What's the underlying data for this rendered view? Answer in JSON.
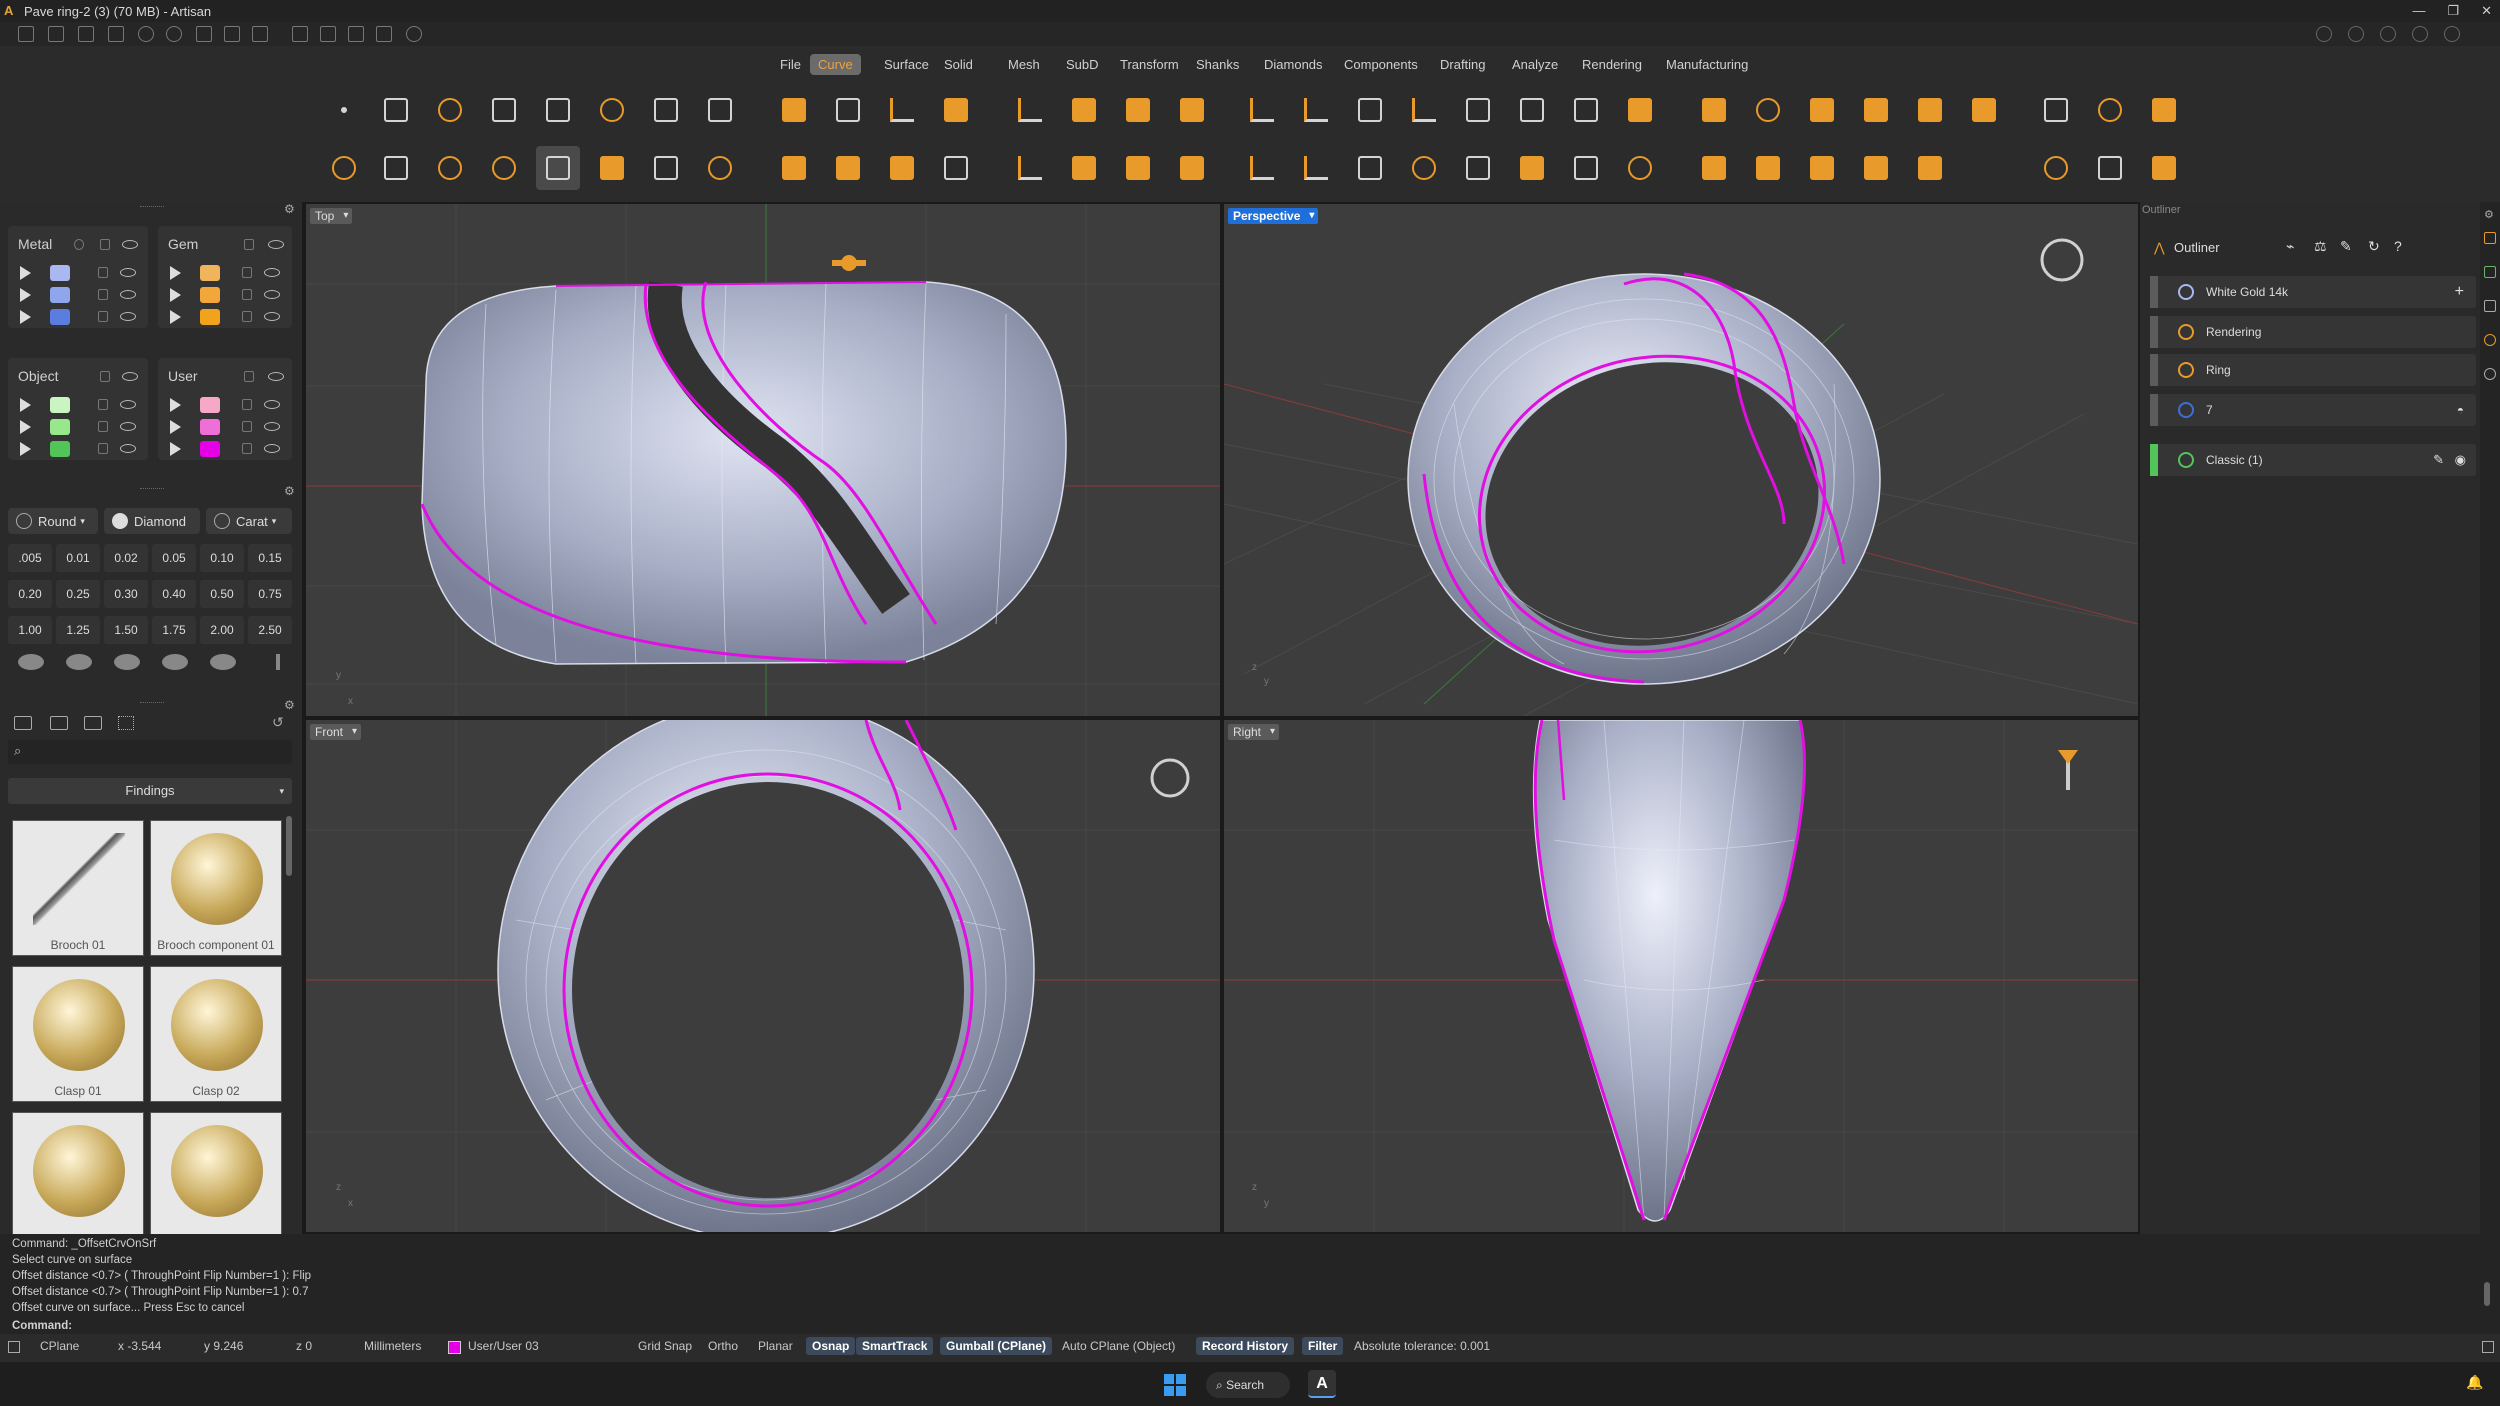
{
  "window": {
    "title": "Pave ring-2 (3) (70 MB) - Artisan",
    "controls": [
      "minimize",
      "restore",
      "close"
    ]
  },
  "menu": {
    "items": [
      "File",
      "Curve",
      "Surface",
      "Solid",
      "Mesh",
      "SubD",
      "Transform",
      "Shanks",
      "Diamonds",
      "Components",
      "Drafting",
      "Analyze",
      "Rendering",
      "Manufacturing"
    ],
    "active": "Curve"
  },
  "layers": {
    "metal": {
      "label": "Metal",
      "colors": [
        "#a9b8f0",
        "#8fa6ec",
        "#5b7de0"
      ]
    },
    "gem": {
      "label": "Gem",
      "colors": [
        "#f0b45a",
        "#f3a73b",
        "#f2a31c"
      ]
    },
    "object": {
      "label": "Object",
      "colors": [
        "#c9f5c0",
        "#96e88a",
        "#52c45a"
      ]
    },
    "user": {
      "label": "User",
      "colors": [
        "#f7a8c8",
        "#f06ed8",
        "#e600e6"
      ]
    }
  },
  "gems": {
    "shape_label": "Round",
    "type_label": "Diamond",
    "unit_label": "Carat",
    "carats": [
      ".005",
      "0.01",
      "0.02",
      "0.05",
      "0.10",
      "0.15",
      "0.20",
      "0.25",
      "0.30",
      "0.40",
      "0.50",
      "0.75",
      "1.00",
      "1.25",
      "1.50",
      "1.75",
      "2.00",
      "2.50"
    ]
  },
  "library": {
    "search_placeholder": "",
    "section_label": "Findings",
    "items": [
      "Brooch 01",
      "Brooch component 01",
      "Clasp 01",
      "Clasp 02",
      "",
      ""
    ]
  },
  "viewports": {
    "top": "Top",
    "perspective": "Perspective",
    "front": "Front",
    "right": "Right"
  },
  "outliner": {
    "header": "Outliner",
    "items": [
      {
        "label": "White Gold 14k",
        "color": "#a9b8f0"
      },
      {
        "label": "Rendering",
        "color": "#e89a2a"
      },
      {
        "label": "Ring",
        "color": "#e89a2a"
      },
      {
        "label": "7",
        "color": "#3c6fd8"
      },
      {
        "label": "Classic (1)",
        "color": "#52c45a"
      }
    ]
  },
  "command_history": [
    "Command: _OffsetCrvOnSrf",
    "Select curve on surface",
    "Offset distance <0.7> ( ThroughPoint  Flip  Number=1 ): Flip",
    "Offset distance <0.7> ( ThroughPoint  Flip  Number=1 ): 0.7",
    "Offset curve on surface... Press Esc to cancel"
  ],
  "command_prompt": "Command:",
  "status": {
    "cplane": "CPlane",
    "x": "x -3.544",
    "y": "y 9.246",
    "z": "z 0",
    "units": "Millimeters",
    "layer": "User/User 03",
    "layer_color": "#e600e6",
    "toggles": [
      {
        "label": "Grid Snap",
        "on": false
      },
      {
        "label": "Ortho",
        "on": false
      },
      {
        "label": "Planar",
        "on": false
      },
      {
        "label": "Osnap",
        "on": true
      },
      {
        "label": "SmartTrack",
        "on": true
      },
      {
        "label": "Gumball (CPlane)",
        "on": true
      },
      {
        "label": "Auto CPlane (Object)",
        "on": false
      },
      {
        "label": "Record History",
        "on": true
      },
      {
        "label": "Filter",
        "on": true
      }
    ],
    "tolerance": "Absolute tolerance: 0.001"
  },
  "taskbar": {
    "search_label": "Search"
  }
}
